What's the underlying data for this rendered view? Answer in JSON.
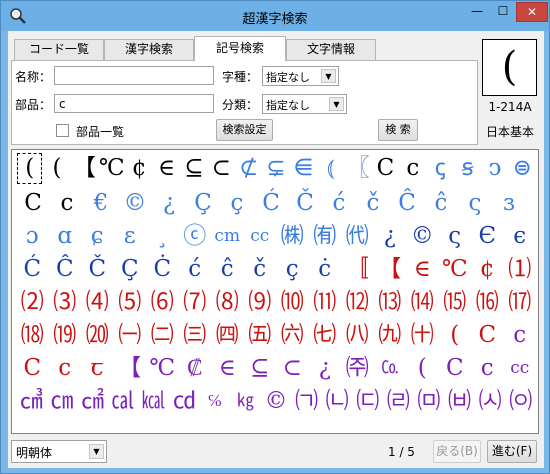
{
  "window": {
    "title": "超漢字検索",
    "minimize_glyph": "—",
    "maximize_glyph": "☐",
    "close_glyph": "✕"
  },
  "tabs": [
    {
      "label": "コード一覧",
      "active": false
    },
    {
      "label": "漢字検索",
      "active": false
    },
    {
      "label": "記号検索",
      "active": true
    },
    {
      "label": "文字情報",
      "active": false
    }
  ],
  "form": {
    "name_label": "名称：",
    "name_value": "",
    "part_label": "部品：",
    "part_value": "c",
    "type_label": "字種：",
    "type_value": "指定なし",
    "class_label": "分類：",
    "class_value": "指定なし",
    "part_list_label": "部品一覧",
    "part_list_checked": false,
    "search_settings_label": "検索設定",
    "search_label": "検 索"
  },
  "preview": {
    "glyph": "(",
    "code": "1-214A",
    "set": "日本基本"
  },
  "grid": {
    "rows": [
      [
        {
          "g": "(",
          "c": "#000",
          "sel": true
        },
        {
          "g": "(",
          "c": "#000"
        },
        {
          "g": "【",
          "c": "#000"
        },
        {
          "g": "℃",
          "c": "#000"
        },
        {
          "g": "¢",
          "c": "#000"
        },
        {
          "g": "∈",
          "c": "#000"
        },
        {
          "g": "⊆",
          "c": "#000"
        },
        {
          "g": "⊂",
          "c": "#000"
        },
        {
          "g": "⊄",
          "c": "#3a7ee0"
        },
        {
          "g": "⊊",
          "c": "#3a7ee0"
        },
        {
          "g": "⋹",
          "c": "#3a7ee0"
        },
        {
          "g": "⦅",
          "c": "#3a7ee0"
        },
        {
          "g": "〖",
          "c": "#3a7ee0"
        },
        {
          "g": "C",
          "c": "#000"
        },
        {
          "g": "c",
          "c": "#000"
        },
        {
          "g": "ꞔ",
          "c": "#3a7ee0"
        },
        {
          "g": "ꞩ",
          "c": "#3a7ee0"
        },
        {
          "g": "ↄ",
          "c": "#3a7ee0"
        },
        {
          "g": "⊜",
          "c": "#3a7ee0"
        }
      ],
      [
        {
          "g": "C",
          "c": "#000"
        },
        {
          "g": "c",
          "c": "#000"
        },
        {
          "g": "€",
          "c": "#3a7ee0"
        },
        {
          "g": "©",
          "c": "#3a7ee0"
        },
        {
          "g": "¿",
          "c": "#3a7ee0"
        },
        {
          "g": "Ç",
          "c": "#3a7ee0"
        },
        {
          "g": "ç",
          "c": "#3a7ee0"
        },
        {
          "g": "Ć",
          "c": "#3a7ee0"
        },
        {
          "g": "Č",
          "c": "#3a7ee0"
        },
        {
          "g": "ć",
          "c": "#3a7ee0"
        },
        {
          "g": "č",
          "c": "#3a7ee0"
        },
        {
          "g": "Ĉ",
          "c": "#3a7ee0"
        },
        {
          "g": "ĉ",
          "c": "#3a7ee0"
        },
        {
          "g": "ς",
          "c": "#3a7ee0"
        },
        {
          "g": "ɜ",
          "c": "#3a7ee0"
        }
      ],
      [
        {
          "g": "ɔ",
          "c": "#3a7ee0"
        },
        {
          "g": "ɑ",
          "c": "#3a7ee0"
        },
        {
          "g": "ɕ",
          "c": "#3a7ee0"
        },
        {
          "g": "ɛ",
          "c": "#3a7ee0"
        },
        {
          "g": "¸",
          "c": "#3a7ee0"
        },
        {
          "g": "ⓒ",
          "c": "#3a7ee0"
        },
        {
          "g": "cm",
          "c": "#3a7ee0",
          "sm": true
        },
        {
          "g": "cc",
          "c": "#3a7ee0",
          "sm": true
        },
        {
          "g": "㈱",
          "c": "#3a7ee0"
        },
        {
          "g": "㈲",
          "c": "#3a7ee0"
        },
        {
          "g": "㈹",
          "c": "#3a7ee0"
        },
        {
          "g": "¿",
          "c": "#1a3ea8"
        },
        {
          "g": "©",
          "c": "#1a3ea8"
        },
        {
          "g": "ς",
          "c": "#1a3ea8"
        },
        {
          "g": "Є",
          "c": "#1a3ea8"
        },
        {
          "g": "є",
          "c": "#1a3ea8"
        }
      ],
      [
        {
          "g": "Ć",
          "c": "#1a3ea8"
        },
        {
          "g": "Ĉ",
          "c": "#1a3ea8"
        },
        {
          "g": "Č",
          "c": "#1a3ea8"
        },
        {
          "g": "Ç",
          "c": "#1a3ea8"
        },
        {
          "g": "Ċ",
          "c": "#1a3ea8"
        },
        {
          "g": "ć",
          "c": "#1a3ea8"
        },
        {
          "g": "ĉ",
          "c": "#1a3ea8"
        },
        {
          "g": "č",
          "c": "#1a3ea8"
        },
        {
          "g": "ç",
          "c": "#1a3ea8"
        },
        {
          "g": "ċ",
          "c": "#1a3ea8"
        },
        {
          "g": "〚",
          "c": "#cc1111"
        },
        {
          "g": "【",
          "c": "#cc1111"
        },
        {
          "g": "∈",
          "c": "#cc1111"
        },
        {
          "g": "℃",
          "c": "#cc1111"
        },
        {
          "g": "¢",
          "c": "#cc1111"
        },
        {
          "g": "⑴",
          "c": "#cc1111"
        }
      ],
      [
        {
          "g": "⑵",
          "c": "#cc1111"
        },
        {
          "g": "⑶",
          "c": "#cc1111"
        },
        {
          "g": "⑷",
          "c": "#cc1111"
        },
        {
          "g": "⑸",
          "c": "#cc1111"
        },
        {
          "g": "⑹",
          "c": "#cc1111"
        },
        {
          "g": "⑺",
          "c": "#cc1111"
        },
        {
          "g": "⑻",
          "c": "#cc1111"
        },
        {
          "g": "⑼",
          "c": "#cc1111"
        },
        {
          "g": "⑽",
          "c": "#cc1111"
        },
        {
          "g": "⑾",
          "c": "#cc1111"
        },
        {
          "g": "⑿",
          "c": "#cc1111"
        },
        {
          "g": "⒀",
          "c": "#cc1111"
        },
        {
          "g": "⒁",
          "c": "#cc1111"
        },
        {
          "g": "⒂",
          "c": "#cc1111"
        },
        {
          "g": "⒃",
          "c": "#cc1111"
        },
        {
          "g": "⒄",
          "c": "#cc1111"
        }
      ],
      [
        {
          "g": "⒅",
          "c": "#cc1111"
        },
        {
          "g": "⒆",
          "c": "#cc1111"
        },
        {
          "g": "⒇",
          "c": "#cc1111"
        },
        {
          "g": "㈠",
          "c": "#cc1111"
        },
        {
          "g": "㈡",
          "c": "#cc1111"
        },
        {
          "g": "㈢",
          "c": "#cc1111"
        },
        {
          "g": "㈣",
          "c": "#cc1111"
        },
        {
          "g": "㈤",
          "c": "#cc1111"
        },
        {
          "g": "㈥",
          "c": "#cc1111"
        },
        {
          "g": "㈦",
          "c": "#cc1111"
        },
        {
          "g": "㈧",
          "c": "#cc1111"
        },
        {
          "g": "㈨",
          "c": "#cc1111"
        },
        {
          "g": "㈩",
          "c": "#cc1111"
        },
        {
          "g": "(",
          "c": "#cc1111"
        },
        {
          "g": "C",
          "c": "#cc1111"
        },
        {
          "g": "c",
          "c": "#7a22b8"
        }
      ],
      [
        {
          "g": "C",
          "c": "#cc1111"
        },
        {
          "g": "c",
          "c": "#cc1111"
        },
        {
          "g": "ꞇ",
          "c": "#cc1111"
        },
        {
          "g": "【",
          "c": "#7a22b8"
        },
        {
          "g": "℃",
          "c": "#7a22b8"
        },
        {
          "g": "₡",
          "c": "#7a22b8"
        },
        {
          "g": "∈",
          "c": "#7a22b8"
        },
        {
          "g": "⊆",
          "c": "#7a22b8"
        },
        {
          "g": "⊂",
          "c": "#7a22b8"
        },
        {
          "g": "¿",
          "c": "#7a22b8"
        },
        {
          "g": "㈜",
          "c": "#7a22b8"
        },
        {
          "g": "㏇",
          "c": "#7a22b8",
          "sm": true
        },
        {
          "g": "(",
          "c": "#7a22b8"
        },
        {
          "g": "C",
          "c": "#7a22b8"
        },
        {
          "g": "c",
          "c": "#7a22b8"
        },
        {
          "g": "cc",
          "c": "#7a22b8",
          "sm": true
        }
      ],
      [
        {
          "g": "㎤",
          "c": "#7a22b8"
        },
        {
          "g": "㎝",
          "c": "#7a22b8"
        },
        {
          "g": "㎠",
          "c": "#7a22b8"
        },
        {
          "g": "㎈",
          "c": "#7a22b8"
        },
        {
          "g": "㎉",
          "c": "#7a22b8"
        },
        {
          "g": "㏅",
          "c": "#7a22b8"
        },
        {
          "g": "℅",
          "c": "#7a22b8",
          "sm": true
        },
        {
          "g": "㎏",
          "c": "#7a22b8",
          "sm": true
        },
        {
          "g": "©",
          "c": "#7a22b8"
        },
        {
          "g": "㈀",
          "c": "#7a22b8"
        },
        {
          "g": "㈁",
          "c": "#7a22b8"
        },
        {
          "g": "㈂",
          "c": "#7a22b8"
        },
        {
          "g": "㈃",
          "c": "#7a22b8"
        },
        {
          "g": "㈄",
          "c": "#7a22b8"
        },
        {
          "g": "㈅",
          "c": "#7a22b8"
        },
        {
          "g": "㈆",
          "c": "#7a22b8"
        },
        {
          "g": "㈇",
          "c": "#7a22b8"
        }
      ]
    ]
  },
  "footer": {
    "font_value": "明朝体",
    "page": "1 / 5",
    "back_label": "戻る(B)",
    "next_label": "進む(F)"
  }
}
